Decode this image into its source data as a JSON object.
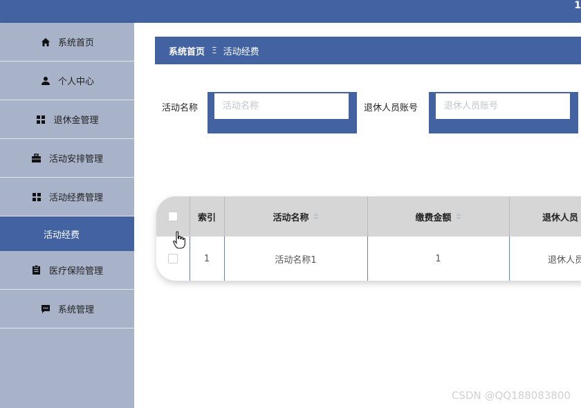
{
  "header": {
    "user_text": "1"
  },
  "sidebar": {
    "items": [
      {
        "label": "系统首页",
        "icon": "home-icon"
      },
      {
        "label": "个人中心",
        "icon": "person-icon"
      },
      {
        "label": "退休金管理",
        "icon": "grid-icon"
      },
      {
        "label": "活动安排管理",
        "icon": "briefcase-icon"
      },
      {
        "label": "活动经费管理",
        "icon": "grid-icon"
      },
      {
        "label": "活动经费",
        "icon": ""
      },
      {
        "label": "医疗保险管理",
        "icon": "clipboard-icon"
      },
      {
        "label": "系统管理",
        "icon": "chat-icon"
      }
    ],
    "active_index": 5
  },
  "breadcrumb": {
    "home": "系统首页",
    "separator": "Ξ",
    "current": "活动经费"
  },
  "search": {
    "activity_label": "活动名称",
    "activity_placeholder": "活动名称",
    "retiree_label": "退休人员账号",
    "retiree_placeholder": "退休人员账号"
  },
  "table": {
    "columns": [
      "索引",
      "活动名称",
      "缴费金额",
      "退休人员"
    ],
    "rows": [
      {
        "index": "1",
        "activity": "活动名称1",
        "amount": "1",
        "retiree": "退休人员"
      }
    ]
  },
  "watermark": "CSDN @QQ188083800",
  "colors": {
    "brand": "#4262a2",
    "sidebar": "#a8b3c9",
    "table_header": "#d6d6d6"
  }
}
